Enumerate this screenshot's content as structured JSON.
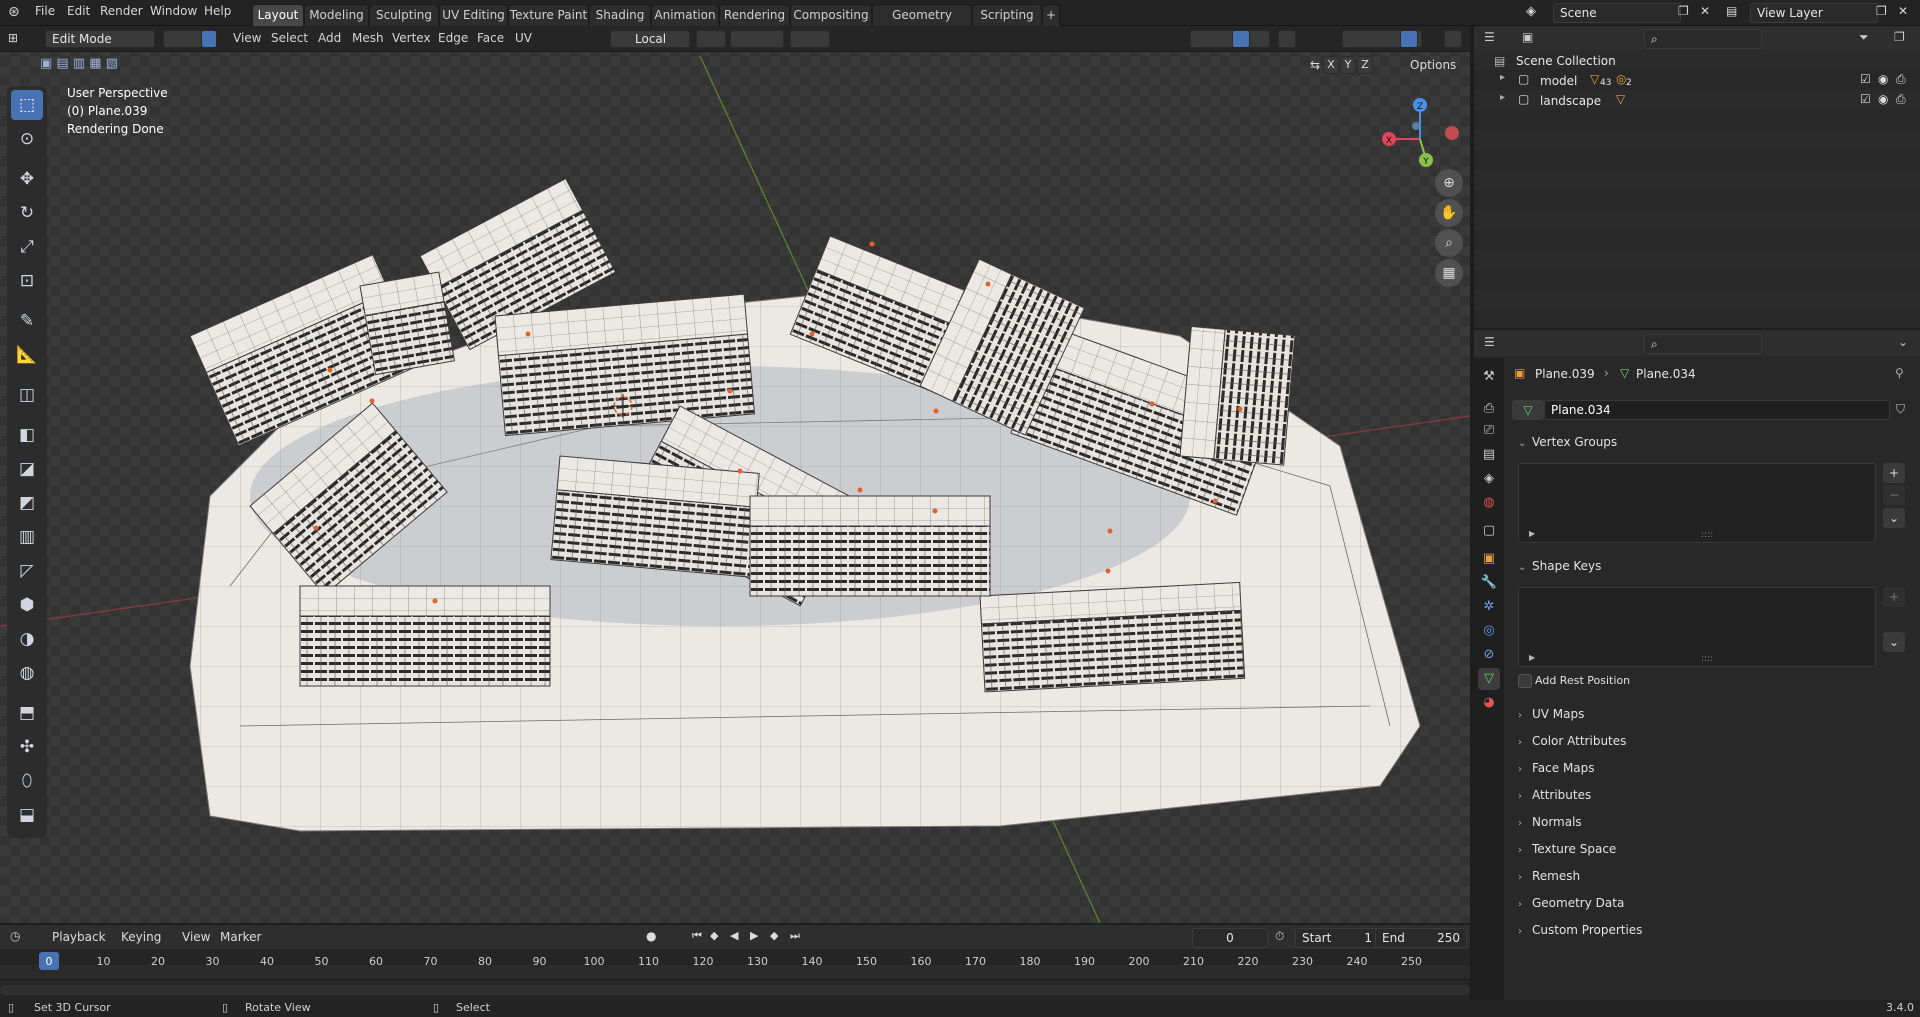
{
  "topbar": {
    "menus": [
      "File",
      "Edit",
      "Render",
      "Window",
      "Help"
    ],
    "workspaces": [
      "Layout",
      "Modeling",
      "Sculpting",
      "UV Editing",
      "Texture Paint",
      "Shading",
      "Animation",
      "Rendering",
      "Compositing",
      "Geometry Nodes",
      "Scripting"
    ],
    "active_workspace": "Layout",
    "add_tab": "+",
    "scene": "Scene",
    "view_layer": "View Layer"
  },
  "viewport": {
    "mode": "Edit Mode",
    "header_menus": [
      "View",
      "Select",
      "Add",
      "Mesh",
      "Vertex",
      "Edge",
      "Face",
      "UV"
    ],
    "orientation": "Local",
    "axes": [
      "X",
      "Y",
      "Z"
    ],
    "options_label": "Options",
    "info_lines": [
      "User Perspective",
      "(0) Plane.039",
      "Rendering Done"
    ],
    "gizmo": {
      "x": "X",
      "y": "Y",
      "z": "Z"
    }
  },
  "outliner": {
    "root": "Scene Collection",
    "collections": [
      {
        "name": "model",
        "badge": "43",
        "badge2": "2"
      },
      {
        "name": "landscape"
      }
    ]
  },
  "properties": {
    "object_name": "Plane.039",
    "mesh_name": "Plane.034",
    "datablock": "Plane.034",
    "panels_open": [
      "Vertex Groups",
      "Shape Keys"
    ],
    "add_rest_position": "Add Rest Position",
    "panels_closed": [
      "UV Maps",
      "Color Attributes",
      "Face Maps",
      "Attributes",
      "Normals",
      "Texture Space",
      "Remesh",
      "Geometry Data",
      "Custom Properties"
    ]
  },
  "timeline": {
    "menus": [
      "Playback",
      "Keying",
      "View",
      "Marker"
    ],
    "current_frame": "0",
    "start_label": "Start",
    "start": "1",
    "end_label": "End",
    "end": "250",
    "ticks": [
      "0",
      "10",
      "20",
      "30",
      "40",
      "50",
      "60",
      "70",
      "80",
      "90",
      "100",
      "110",
      "120",
      "130",
      "140",
      "150",
      "160",
      "170",
      "180",
      "190",
      "200",
      "210",
      "220",
      "230",
      "240",
      "250"
    ]
  },
  "statusbar": {
    "left": "Set 3D Cursor",
    "middle": "Rotate View",
    "right": "Select",
    "version": "3.4.0"
  },
  "colors": {
    "accent": "#4772b3",
    "vertex_orange": "#e0632d",
    "x_axis": "#e0455b",
    "y_axis": "#8bc34a",
    "z_axis": "#4b8fe8"
  }
}
